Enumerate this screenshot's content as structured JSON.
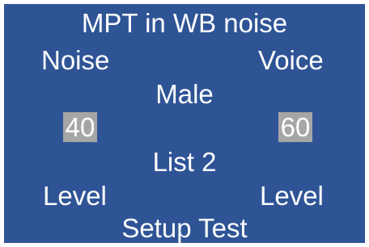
{
  "screen": {
    "title": "MPT in WB noise",
    "noise": {
      "label": "Noise",
      "value": "40",
      "level_label": "Level"
    },
    "voice": {
      "label": "Voice",
      "value": "60",
      "level_label": "Level"
    },
    "talker": "Male",
    "list": "List 2",
    "setup_label": "Setup Test"
  },
  "colors": {
    "panel_background": "#2f5496",
    "value_box_background": "#a6a6a6",
    "text": "#ffffff"
  }
}
